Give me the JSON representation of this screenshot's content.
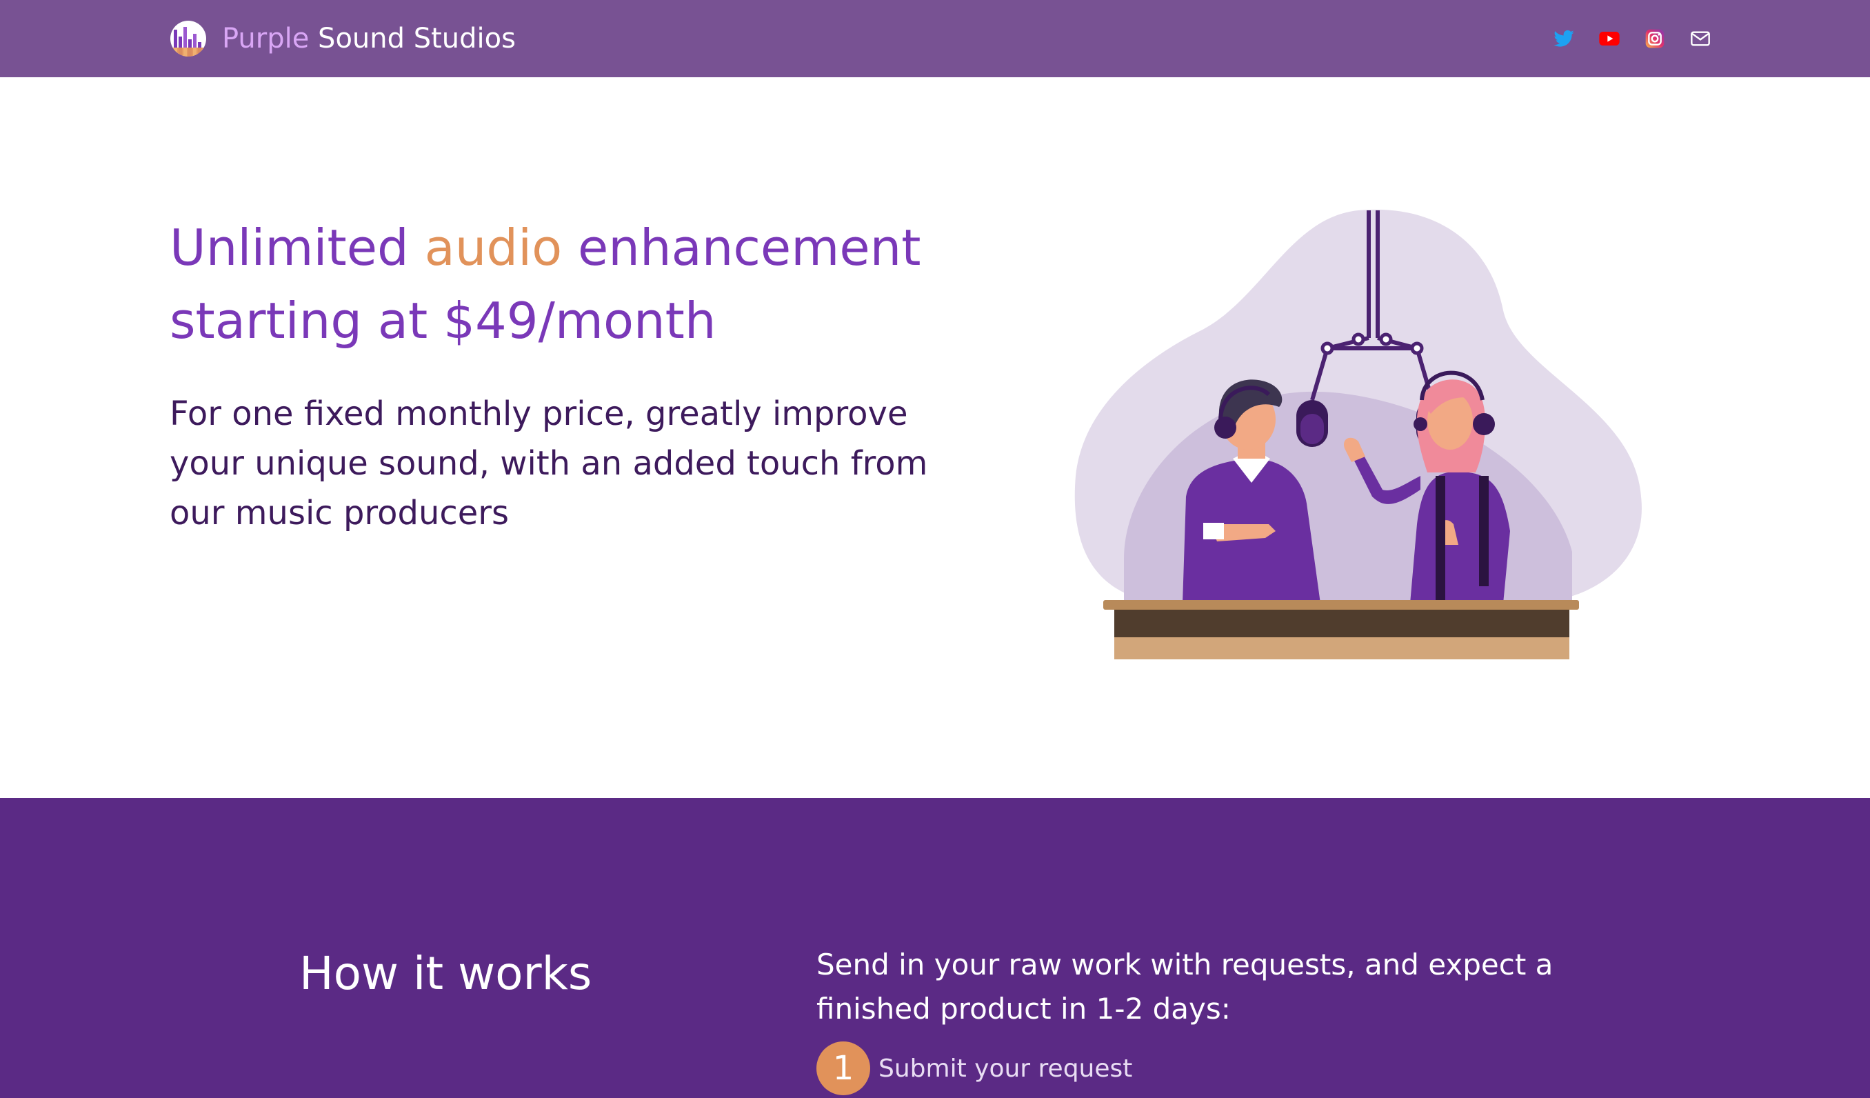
{
  "nav": {
    "brand_accent": "Purple",
    "brand_rest": "Sound Studios",
    "social_icons": [
      "twitter-icon",
      "youtube-icon",
      "instagram-icon",
      "mail-icon"
    ]
  },
  "hero": {
    "title_part1": "Unlimited ",
    "title_highlight": "audio",
    "title_part2": " enhancement starting at $49/month",
    "subtitle": "For one fixed monthly price, greatly improve your unique sound, with an added touch from our music producers"
  },
  "how": {
    "title": "How it works",
    "intro": "Send in your raw work with requests, and expect a finished product in 1-2 days:",
    "steps": [
      {
        "number": "1",
        "label": "Submit your request"
      }
    ]
  },
  "colors": {
    "nav_bg": "#785293",
    "brand_accent": "#d9a6f5",
    "heading_purple": "#7a38b8",
    "highlight_orange": "#e1925a",
    "body_text": "#3d1a5c",
    "section_bg": "#5b2a85"
  }
}
